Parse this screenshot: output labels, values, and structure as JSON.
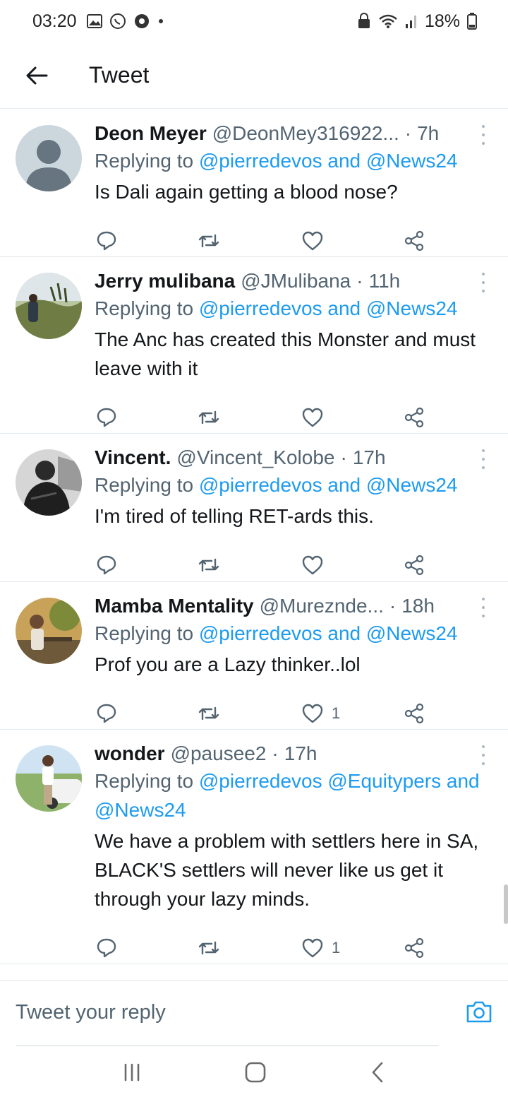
{
  "status_bar": {
    "time": "03:20",
    "battery": "18%"
  },
  "header": {
    "title": "Tweet"
  },
  "tweets": [
    {
      "name": "Deon Meyer",
      "handle": "@DeonMey316922...",
      "age": "7h",
      "replying_prefix": "Replying to",
      "mentions": "@pierredevos and @News24",
      "text": "Is Dali again getting a blood nose?",
      "likes": ""
    },
    {
      "name": "Jerry mulibana",
      "handle": "@JMulibana",
      "age": "11h",
      "replying_prefix": "Replying to",
      "mentions": "@pierredevos and @News24",
      "text": "The Anc has created this Monster and must leave with it",
      "likes": ""
    },
    {
      "name": "Vincent.",
      "handle": "@Vincent_Kolobe",
      "age": "17h",
      "replying_prefix": "Replying to",
      "mentions": "@pierredevos and @News24",
      "text": "I'm tired of telling RET-ards this.",
      "likes": ""
    },
    {
      "name": "Mamba Mentality",
      "handle": "@Mureznde...",
      "age": "18h",
      "replying_prefix": "Replying to",
      "mentions": "@pierredevos and @News24",
      "text": "Prof you are a Lazy thinker..lol",
      "likes": "1"
    },
    {
      "name": "wonder",
      "handle": "@pausee2",
      "age": "17h",
      "replying_prefix": "Replying to",
      "mentions": "@pierredevos @Equitypers and @News24",
      "text": "We have a problem with settlers here in SA, BLACK'S settlers will never like us get it through your lazy minds.",
      "likes": "1"
    }
  ],
  "reply_bar": {
    "placeholder": "Tweet your reply"
  },
  "colors": {
    "accent": "#1d9bf0",
    "secondary_text": "#536471",
    "primary_text": "#14171a"
  },
  "icons": [
    "back-arrow-icon",
    "reply-icon",
    "retweet-icon",
    "like-icon",
    "share-icon",
    "more-icon",
    "camera-icon",
    "recents-icon",
    "home-icon",
    "nav-back-icon"
  ]
}
